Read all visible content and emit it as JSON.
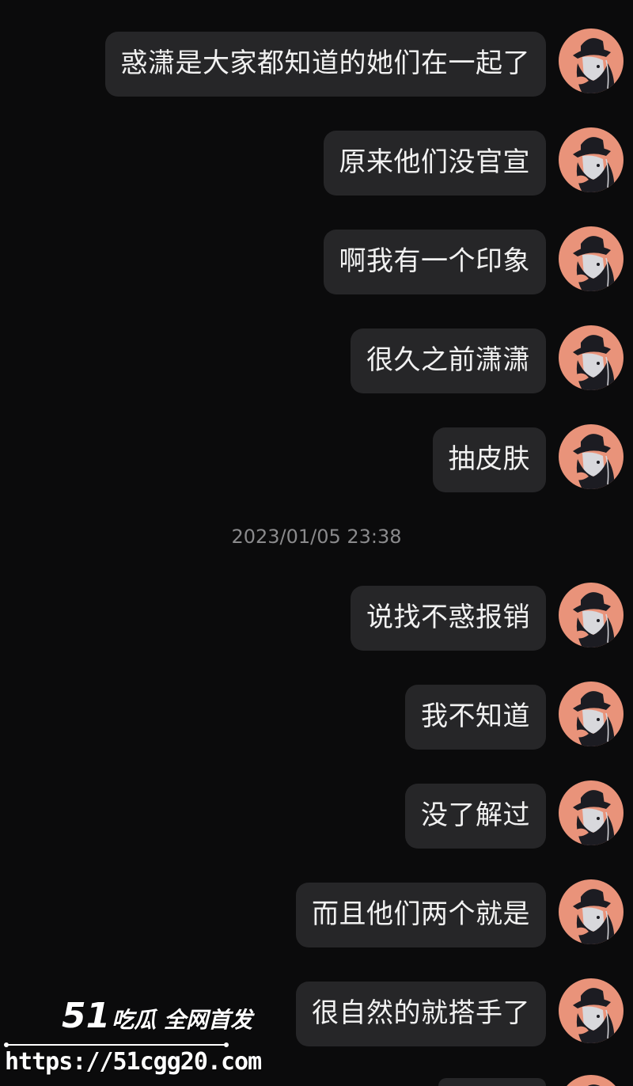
{
  "messages": [
    {
      "text": "惑潇是大家都知道的她们在一起了",
      "avatar": "user-avatar"
    },
    {
      "text": "原来他们没官宣",
      "avatar": "user-avatar"
    },
    {
      "text": "啊我有一个印象",
      "avatar": "user-avatar"
    },
    {
      "text": "很久之前潇潇",
      "avatar": "user-avatar"
    },
    {
      "text": "抽皮肤",
      "avatar": "user-avatar"
    },
    {
      "text": "说找不惑报销",
      "avatar": "user-avatar"
    },
    {
      "text": "我不知道",
      "avatar": "user-avatar"
    },
    {
      "text": "没了解过",
      "avatar": "user-avatar"
    },
    {
      "text": "而且他们两个就是",
      "avatar": "user-avatar"
    },
    {
      "text": "很自然的就搭手了",
      "avatar": "user-avatar"
    }
  ],
  "timestamp": "2023/01/05 23:38",
  "watermark": {
    "brand_number": "51",
    "brand_text": "吃瓜 全网首发",
    "url": "https://51cgg20.com"
  },
  "colors": {
    "background": "#0b0b0c",
    "bubble": "#262628",
    "bubble_text": "#f1f1f1",
    "timestamp_text": "#8a8a8c",
    "avatar_bg": "#e9937a"
  }
}
